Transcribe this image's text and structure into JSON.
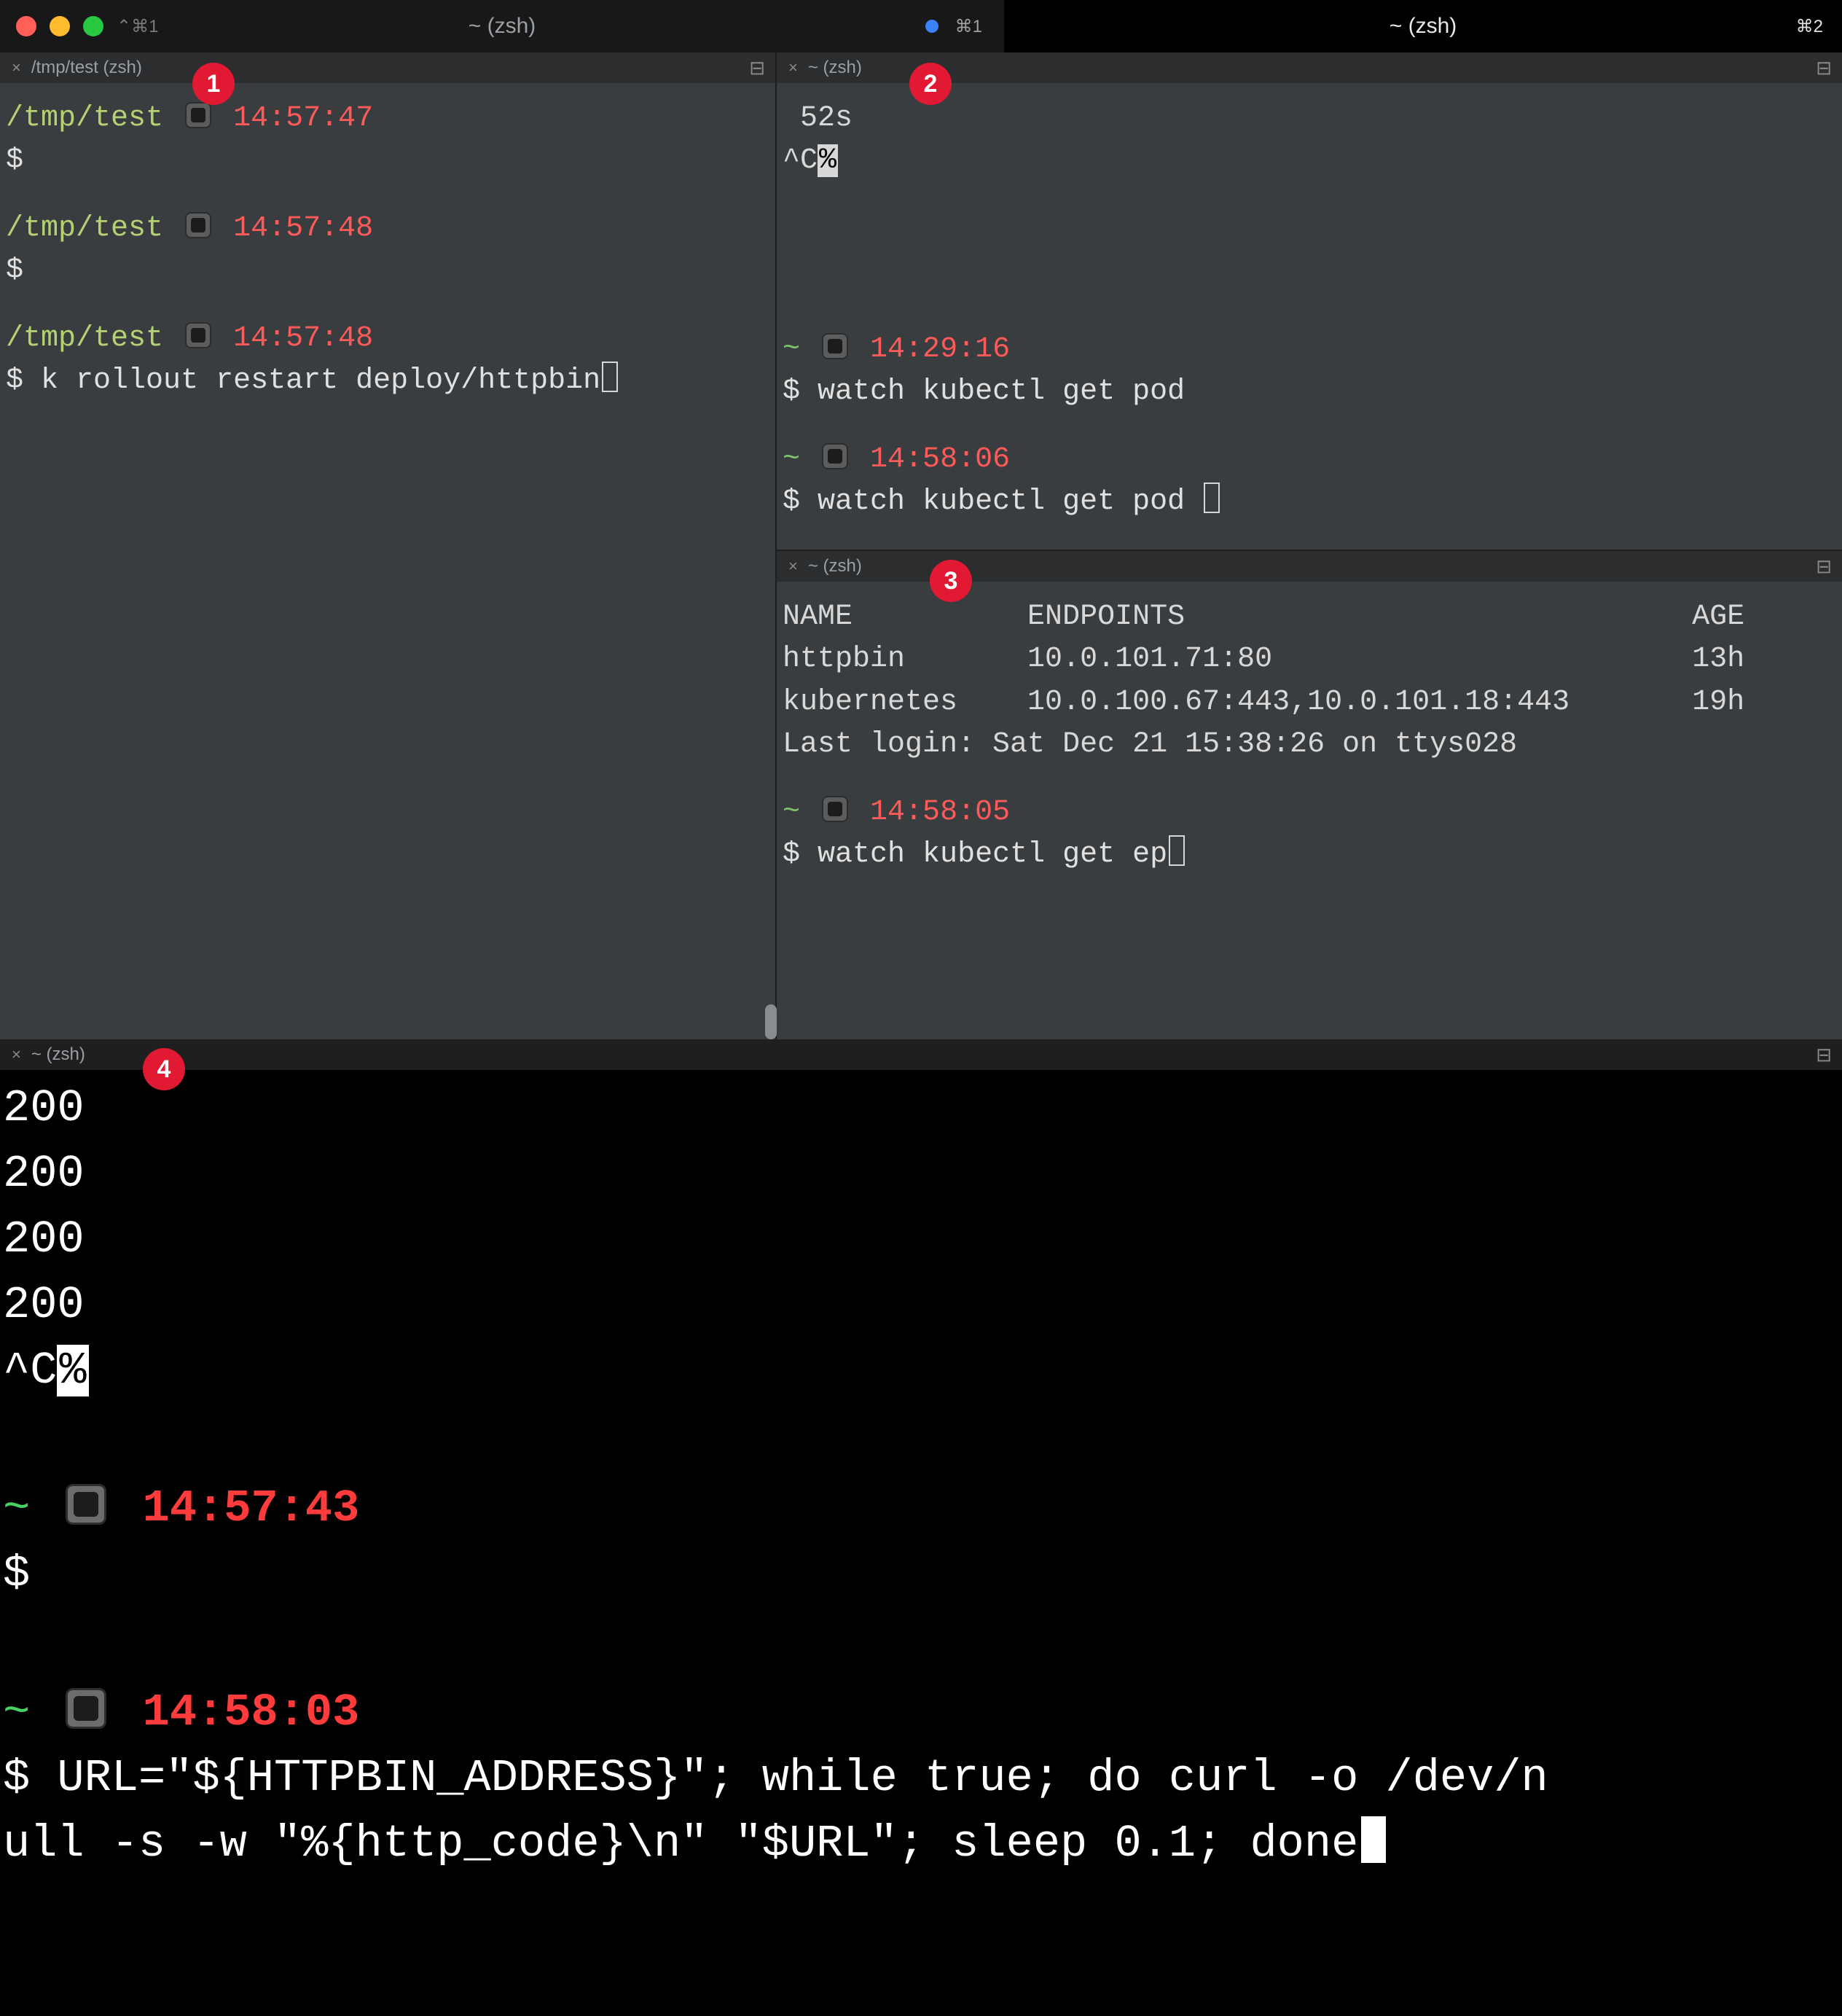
{
  "titlebar": {
    "shortcut_left": "⌃⌘1",
    "tab_left_title": "~ (zsh)",
    "tab_left_shortcut": "⌘1",
    "tab_right_title": "~ (zsh)",
    "tab_right_shortcut": "⌘2"
  },
  "badges": {
    "b1": "1",
    "b2": "2",
    "b3": "3",
    "b4": "4"
  },
  "pane1": {
    "tab": "/tmp/test (zsh)",
    "blocks": [
      {
        "path": "/tmp/test",
        "time": "14:57:47",
        "cmd": ""
      },
      {
        "path": "/tmp/test",
        "time": "14:57:48",
        "cmd": ""
      },
      {
        "path": "/tmp/test",
        "time": "14:57:48",
        "cmd": "k rollout restart deploy/httpbin",
        "cursor": true
      }
    ]
  },
  "pane2": {
    "tab": "~ (zsh)",
    "top_line": " 52s",
    "ctrlc": "^C",
    "ctrlc_pct": "%",
    "blocks": [
      {
        "tilde": "~",
        "time": "14:29:16",
        "cmd": "watch kubectl get pod"
      },
      {
        "tilde": "~",
        "time": "14:58:06",
        "cmd": "watch kubectl get pod ",
        "cursor": true
      }
    ]
  },
  "pane3": {
    "tab": "~ (zsh)",
    "table": {
      "header": "NAME          ENDPOINTS                             AGE",
      "rows": [
        "httpbin       10.0.101.71:80                        13h",
        "kubernetes    10.0.100.67:443,10.0.101.18:443       19h"
      ]
    },
    "last_login": "Last login: Sat Dec 21 15:38:26 on ttys028",
    "block": {
      "tilde": "~",
      "time": "14:58:05",
      "cmd": "watch kubectl get ep",
      "cursor": true
    }
  },
  "pane4": {
    "tab": "~ (zsh)",
    "lines": [
      "200",
      "200",
      "200",
      "200"
    ],
    "ctrlc": "^C",
    "ctrlc_pct": "%",
    "blocks": [
      {
        "tilde": "~",
        "time": "14:57:43",
        "cmd": ""
      },
      {
        "tilde": "~",
        "time": "14:58:03",
        "cmd_l1": "$ URL=\"${HTTPBIN_ADDRESS}\"; while true; do curl -o /dev/n",
        "cmd_l2": "ull -s -w \"%{http_code}\\n\" \"$URL\"; sleep 0.1; done",
        "cursor": true
      }
    ]
  }
}
